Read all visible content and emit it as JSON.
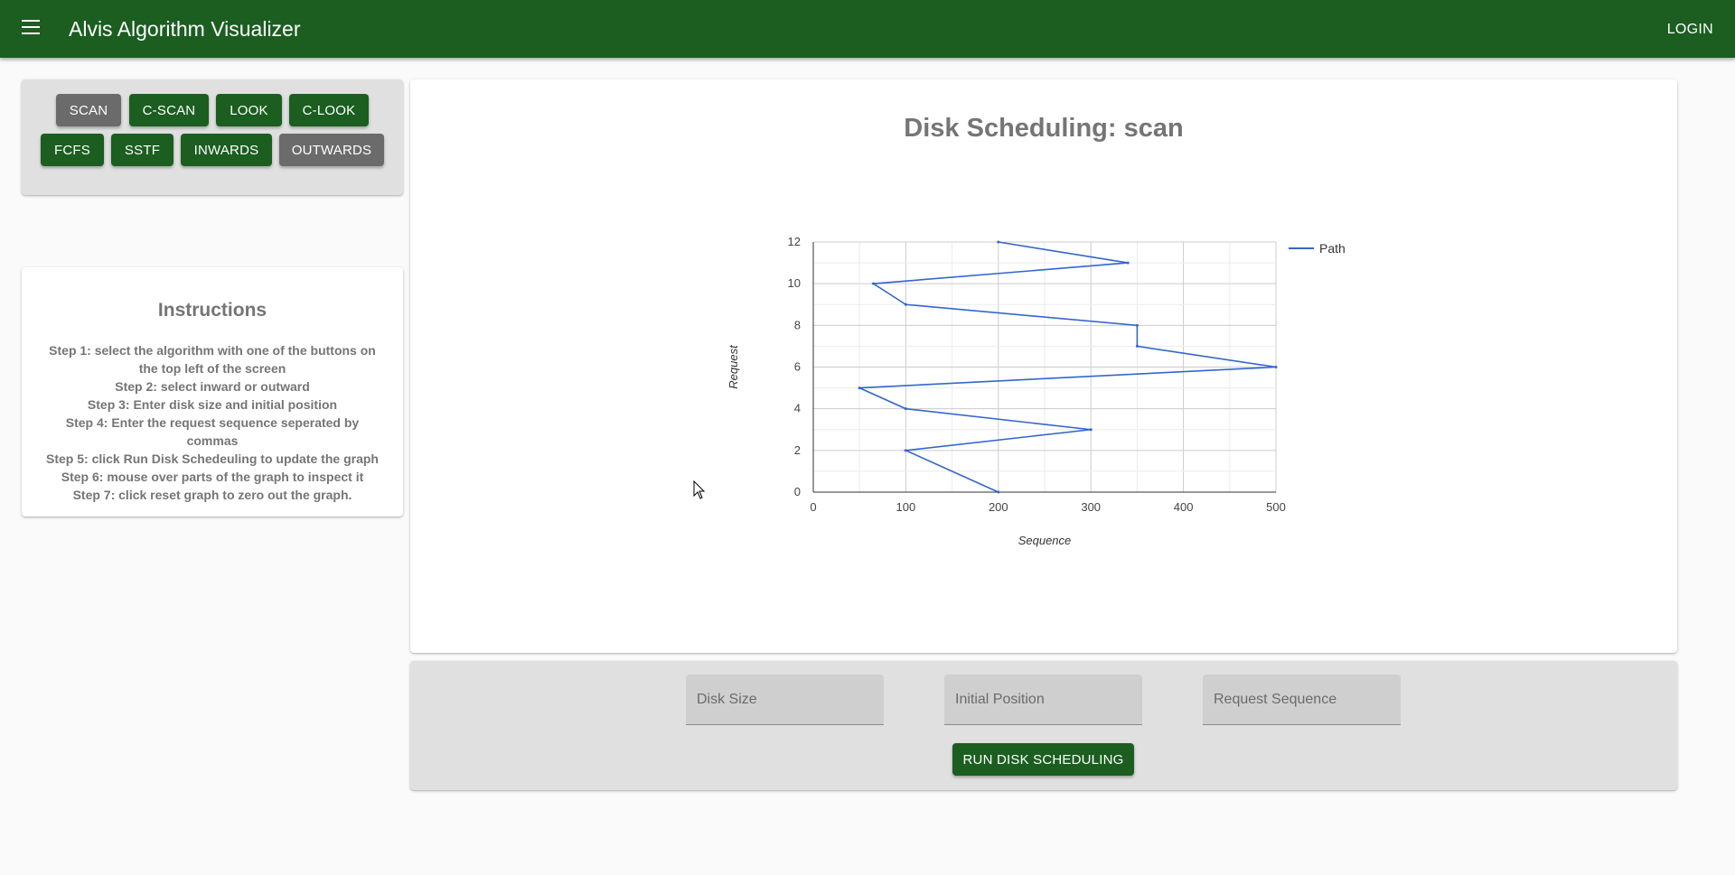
{
  "app": {
    "title": "Alvis Algorithm Visualizer",
    "login_label": "LOGIN",
    "brand_color": "#1b5e20"
  },
  "algorithm_buttons": [
    {
      "label": "SCAN",
      "state": "selected"
    },
    {
      "label": "C-SCAN",
      "state": "normal"
    },
    {
      "label": "LOOK",
      "state": "normal"
    },
    {
      "label": "C-LOOK",
      "state": "normal"
    },
    {
      "label": "FCFS",
      "state": "normal"
    },
    {
      "label": "SSTF",
      "state": "normal"
    },
    {
      "label": "INWARDS",
      "state": "normal"
    },
    {
      "label": "OUTWARDS",
      "state": "selected"
    }
  ],
  "instructions": {
    "title": "Instructions",
    "steps": [
      "Step 1: select the algorithm with one of the buttons on the top left of the screen",
      "Step 2: select inward or outward",
      "Step 3: Enter disk size and initial position",
      "Step 4: Enter the request sequence seperated by commas",
      "Step 5: click Run Disk Schedeuling to update the graph",
      "Step 6: mouse over parts of the graph to inspect it",
      "Step 7: click reset graph to zero out the graph."
    ]
  },
  "chart": {
    "title": "Disk Scheduling: scan"
  },
  "chart_data": {
    "type": "line",
    "xlabel": "Sequence",
    "ylabel": "Request",
    "xlim": [
      0,
      500
    ],
    "ylim": [
      0,
      12
    ],
    "x_ticks": [
      "0",
      "100",
      "200",
      "300",
      "400",
      "500"
    ],
    "y_ticks": [
      "0",
      "2",
      "4",
      "6",
      "8",
      "10",
      "12"
    ],
    "grid": true,
    "legend_position": "right",
    "series": [
      {
        "name": "Path",
        "color": "#3366cc",
        "points": [
          {
            "x": 200,
            "y": 0
          },
          {
            "x": 100,
            "y": 2
          },
          {
            "x": 300,
            "y": 3
          },
          {
            "x": 100,
            "y": 4
          },
          {
            "x": 50,
            "y": 5
          },
          {
            "x": 500,
            "y": 6
          },
          {
            "x": 350,
            "y": 7
          },
          {
            "x": 350,
            "y": 8
          },
          {
            "x": 100,
            "y": 9
          },
          {
            "x": 65,
            "y": 10
          },
          {
            "x": 340,
            "y": 11
          },
          {
            "x": 200,
            "y": 12
          }
        ]
      }
    ]
  },
  "form": {
    "disk_size_placeholder": "Disk Size",
    "initial_position_placeholder": "Initial Position",
    "request_sequence_placeholder": "Request Sequence",
    "run_label": "RUN DISK SCHEDULING"
  }
}
